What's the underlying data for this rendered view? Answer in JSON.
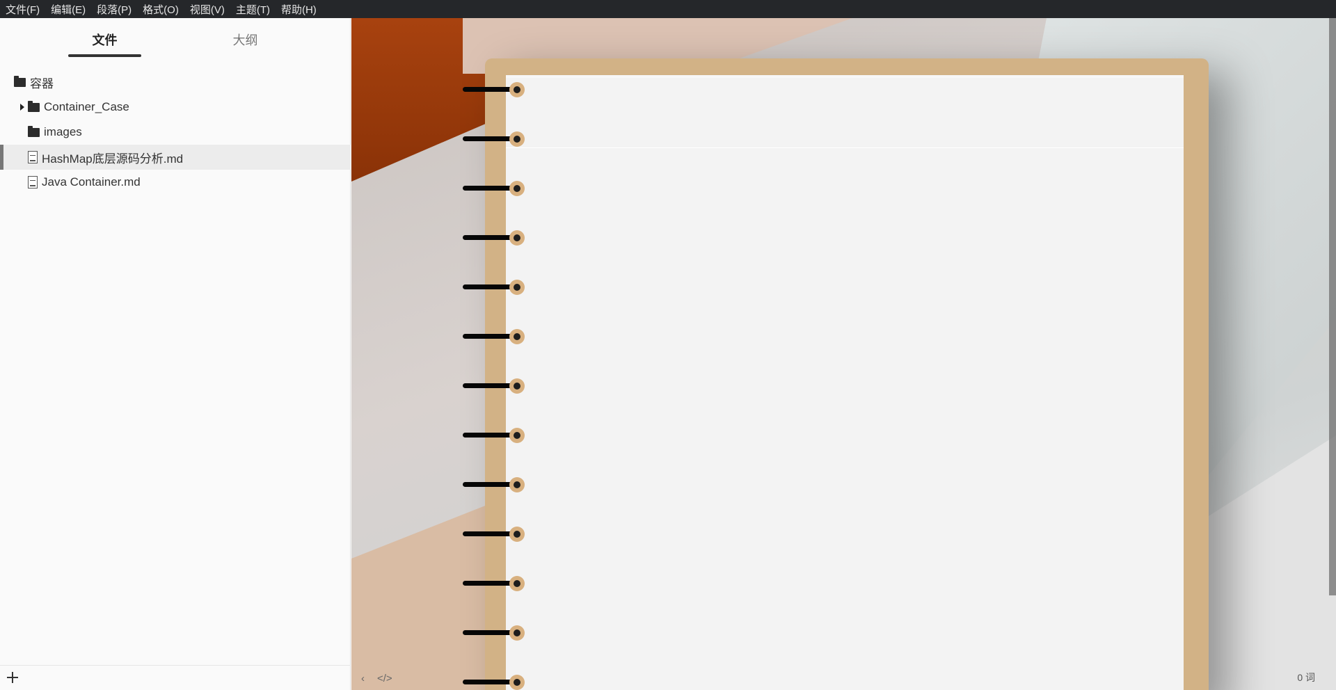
{
  "menu": {
    "items": [
      "文件(F)",
      "编辑(E)",
      "段落(P)",
      "格式(O)",
      "视图(V)",
      "主题(T)",
      "帮助(H)"
    ]
  },
  "sidebar": {
    "tabs": {
      "files": "文件",
      "outline": "大纲"
    },
    "tree": {
      "root": {
        "label": "容器",
        "icon": "folder-icon"
      },
      "children": [
        {
          "label": "Container_Case",
          "icon": "folder-icon",
          "collapsed": true
        },
        {
          "label": "images",
          "icon": "folder-icon"
        },
        {
          "label": "HashMap底层源码分析.md",
          "icon": "file-icon",
          "selected": true
        },
        {
          "label": "Java Container.md",
          "icon": "file-icon"
        }
      ]
    },
    "footer": {
      "add_icon": "plus-icon"
    }
  },
  "editor": {
    "status": {
      "toggle_sidebar_icon": "chevron-left-icon",
      "source_mode_icon": "code-icon",
      "toggle_sidebar_glyph": "‹",
      "source_mode_glyph": "</>",
      "word_count": "0 词"
    },
    "colors": {
      "notebook_cover": "#d2b286",
      "paper": "#f3f3f3",
      "menubar": "#25272a"
    }
  }
}
